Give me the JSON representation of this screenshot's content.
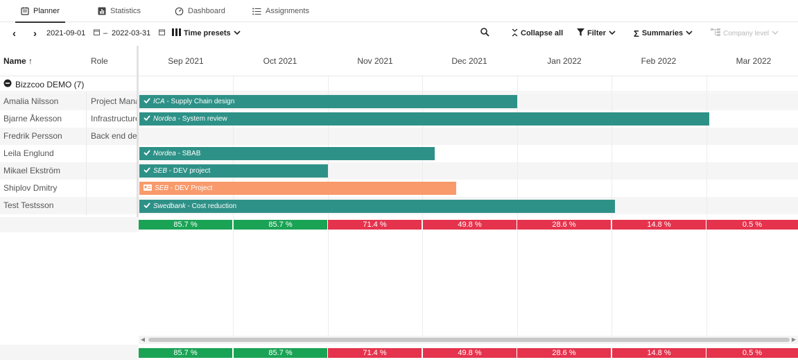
{
  "nav": {
    "tabs": [
      {
        "label": "Planner",
        "icon": "planner-icon",
        "active": true
      },
      {
        "label": "Statistics",
        "icon": "statistics-icon"
      },
      {
        "label": "Dashboard",
        "icon": "dashboard-icon"
      },
      {
        "label": "Assignments",
        "icon": "assignments-icon"
      }
    ]
  },
  "toolbar": {
    "prev": "‹",
    "next": "›",
    "date_from": "2021-09-01",
    "date_sep": "–",
    "date_to": "2022-03-31",
    "time_presets": "Time presets",
    "collapse_all": "Collapse all",
    "filter": "Filter",
    "summaries": "Summaries",
    "company_level": "Company level"
  },
  "columns": {
    "name": "Name ↑",
    "role": "Role"
  },
  "months": [
    "Sep 2021",
    "Oct 2021",
    "Nov 2021",
    "Dec 2021",
    "Jan 2022",
    "Feb 2022",
    "Mar 2022"
  ],
  "group": {
    "label": "Bizzcoo DEMO (7)"
  },
  "people": [
    {
      "name": "Amalia Nilsson",
      "role": "Project Manager"
    },
    {
      "name": "Bjarne Åkesson",
      "role": "Infrastructure"
    },
    {
      "name": "Fredrik Persson",
      "role": "Back end developer"
    },
    {
      "name": "Leila Englund",
      "role": ""
    },
    {
      "name": "Mikael Ekström",
      "role": ""
    },
    {
      "name": "Shiplov Dmitry",
      "role": ""
    },
    {
      "name": "Test Testsson",
      "role": ""
    }
  ],
  "bars": [
    {
      "client": "ICA",
      "project": " - Supply Chain design",
      "status": "confirmed"
    },
    {
      "client": "Nordea",
      "project": " - System review",
      "status": "confirmed"
    },
    {
      "client": "Nordea",
      "project": " - SBAB",
      "status": "confirmed"
    },
    {
      "client": "SEB",
      "project": " - DEV project",
      "status": "confirmed"
    },
    {
      "client": "SEB",
      "project": " - DEV Project",
      "status": "tentative"
    },
    {
      "client": "Swedbank",
      "project": " - Cost reduction",
      "status": "confirmed"
    }
  ],
  "summary": {
    "values": [
      "85.7 %",
      "85.7 %",
      "71.4 %",
      "49.8 %",
      "28.6 %",
      "14.8 %",
      "0.5 %"
    ],
    "levels": [
      "high",
      "high",
      "low",
      "low",
      "low",
      "low",
      "low"
    ]
  },
  "colors": {
    "confirmed": "#2e9187",
    "tentative": "#f89a6c",
    "high": "#1aa355",
    "low": "#e5334d"
  }
}
